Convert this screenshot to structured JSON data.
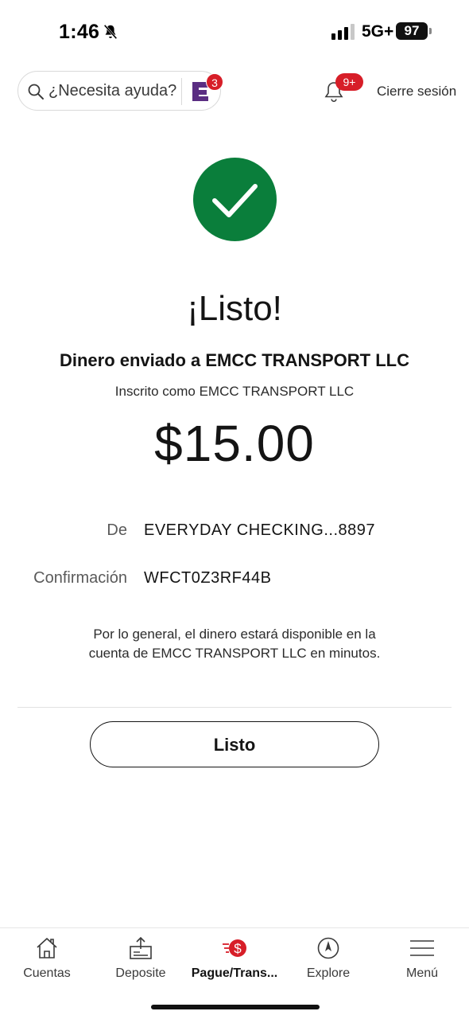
{
  "status_bar": {
    "time": "1:46",
    "network": "5G+",
    "battery": "97"
  },
  "header": {
    "search_placeholder": "¿Necesita ayuda?",
    "assistant_badge": "3",
    "notifications_badge": "9+",
    "logout_label": "Cierre sesión"
  },
  "confirmation": {
    "title": "¡Listo!",
    "subtitle": "Dinero enviado a EMCC TRANSPORT LLC",
    "enrolled_as": "Inscrito como EMCC TRANSPORT LLC",
    "amount": "$15.00",
    "details": [
      {
        "label": "De",
        "value": "EVERYDAY CHECKING...8897"
      },
      {
        "label": "Confirmación",
        "value": "WFCT0Z3RF44B"
      }
    ],
    "note_line1": "Por lo general, el dinero estará disponible en la",
    "note_line2": "cuenta de EMCC TRANSPORT LLC en minutos.",
    "done_label": "Listo"
  },
  "bottom_nav": [
    {
      "label": "Cuentas",
      "icon": "home-icon",
      "active": false
    },
    {
      "label": "Deposite",
      "icon": "deposit-icon",
      "active": false
    },
    {
      "label": "Pague/Trans...",
      "icon": "pay-transfer-icon",
      "active": true
    },
    {
      "label": "Explore",
      "icon": "compass-icon",
      "active": false
    },
    {
      "label": "Menú",
      "icon": "menu-icon",
      "active": false
    }
  ],
  "colors": {
    "brand_red": "#d71e28",
    "success_green": "#0a7e3b",
    "assistant_purple": "#5a2d82"
  }
}
